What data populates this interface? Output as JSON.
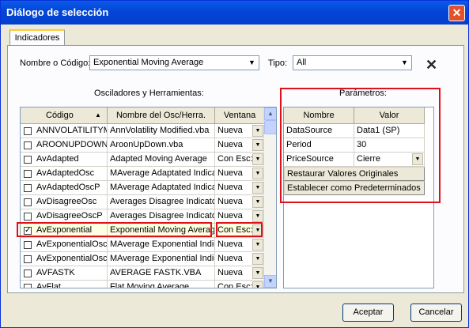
{
  "window": {
    "title": "Diálogo de selección",
    "close_glyph": "✕"
  },
  "tabs": [
    {
      "label": "Indicadores"
    }
  ],
  "filters": {
    "name_label": "Nombre o Código:",
    "name_value": "Exponential Moving Average",
    "type_label": "Tipo:",
    "type_value": "All",
    "clear_icon": "x-icon"
  },
  "left_group": {
    "title": "Osciladores y Herramientas:",
    "columns": [
      "Código",
      "Nombre del Osc/Herra.",
      "Ventana"
    ],
    "sort_indicator": "▲",
    "rows": [
      {
        "checked": false,
        "code": "ANNVOLATILITYMOD",
        "name": "AnnVolatility Modified.vba",
        "window": "Nueva"
      },
      {
        "checked": false,
        "code": "AROONUPDOWN",
        "name": "AroonUpDown.vba",
        "window": "Nueva"
      },
      {
        "checked": false,
        "code": "AvAdapted",
        "name": "Adapted Moving Average",
        "window": "Con Esc:"
      },
      {
        "checked": false,
        "code": "AvAdaptedOsc",
        "name": "MAverage Adaptated Indicator",
        "window": "Nueva"
      },
      {
        "checked": false,
        "code": "AvAdaptedOscP",
        "name": "MAverage Adaptated Indicator %",
        "window": "Nueva"
      },
      {
        "checked": false,
        "code": "AvDisagreeOsc",
        "name": "Averages Disagree Indicator",
        "window": "Nueva"
      },
      {
        "checked": false,
        "code": "AvDisagreeOscP",
        "name": "Averages Disagree Indicator P",
        "window": "Nueva"
      },
      {
        "checked": true,
        "code": "AvExponential",
        "name": "Exponential Moving Average",
        "window": "Con Esc:"
      },
      {
        "checked": false,
        "code": "AvExponentialOsc",
        "name": "MAverage Exponential Indicator",
        "window": "Nueva"
      },
      {
        "checked": false,
        "code": "AvExponentialOscP",
        "name": "MAverage Exponential Indicator",
        "window": "Nueva"
      },
      {
        "checked": false,
        "code": "AVFASTK",
        "name": "AVERAGE FASTK.VBA",
        "window": "Nueva"
      },
      {
        "checked": false,
        "code": "AvFlat",
        "name": "Flat Moving Average",
        "window": "Con Esc:"
      }
    ]
  },
  "right_group": {
    "title": "Parámetros:",
    "columns": [
      "Nombre",
      "Valor"
    ],
    "rows": [
      {
        "name": "DataSource",
        "value": "Data1 (SP)"
      },
      {
        "name": "Period",
        "value": "30"
      },
      {
        "name": "PriceSource",
        "value": "Cierre"
      }
    ],
    "restore_label": "Restaurar Valores Originales",
    "default_label": "Establecer como Predeterminados"
  },
  "buttons": {
    "accept": "Aceptar",
    "cancel": "Cancelar"
  },
  "colors": {
    "highlight": "#e0101a",
    "titlebar": "#0346d8",
    "selected_row": "#ffffe1"
  }
}
